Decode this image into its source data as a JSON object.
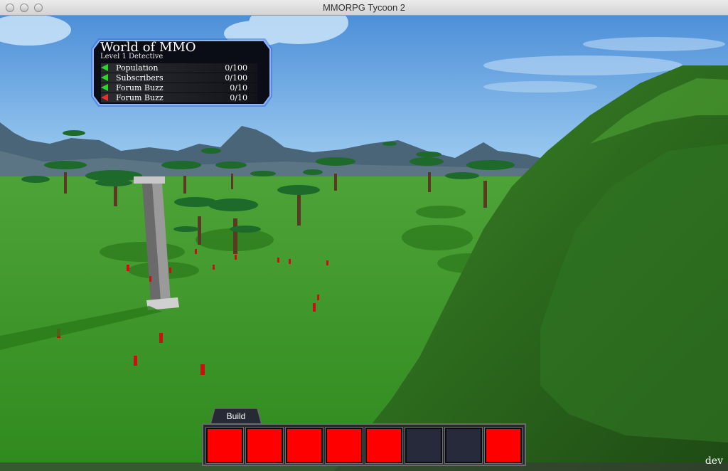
{
  "window": {
    "title": "MMORPG Tycoon 2"
  },
  "hud": {
    "title": "World of MMO",
    "subtitle": "Level 1 Detective",
    "stats": [
      {
        "name": "Population",
        "value": "0/100",
        "trend": "up"
      },
      {
        "name": "Subscribers",
        "value": "0/100",
        "trend": "up"
      },
      {
        "name": "Forum Buzz",
        "value": "0/10",
        "trend": "up"
      },
      {
        "name": "Forum Buzz",
        "value": "0/10",
        "trend": "down"
      }
    ]
  },
  "build": {
    "tab_label": "Build",
    "slots": [
      {
        "color": "#ff0000"
      },
      {
        "color": "#ff0000"
      },
      {
        "color": "#ff0000"
      },
      {
        "color": "#ff0000"
      },
      {
        "color": "#ff0000"
      },
      {
        "color": "#262a3a"
      },
      {
        "color": "#262a3a"
      },
      {
        "color": "#ff0000"
      }
    ]
  },
  "footer": {
    "dev_label": "dev"
  },
  "colors": {
    "sky": "#6fb0e8",
    "grass": "#3f9a2c",
    "hill": "#2a6a1c",
    "marker": "#cc1010"
  }
}
